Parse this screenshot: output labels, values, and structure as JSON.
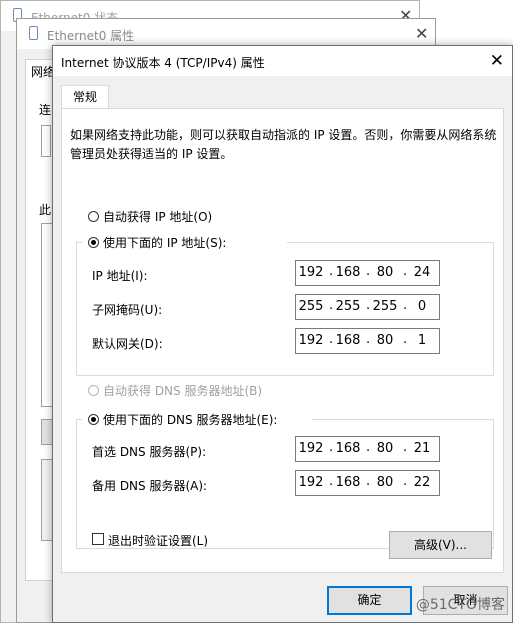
{
  "back_window_1": {
    "title": "Ethernet0 状态"
  },
  "back_window_2": {
    "title": "Ethernet0 属性",
    "tab_fragment": "网络",
    "text_fragment_1": "连",
    "text_fragment_2": "此"
  },
  "dialog": {
    "title": "Internet 协议版本 4 (TCP/IPv4) 属性",
    "tabs": [
      {
        "label": "常规"
      }
    ],
    "description": "如果网络支持此功能，则可以获取自动指派的 IP 设置。否则，你需要从网络系统管理员处获得适当的 IP 设置。",
    "ip_section": {
      "auto_label": "自动获得 IP 地址(O)",
      "manual_label": "使用下面的 IP 地址(S):",
      "fields": [
        {
          "label": "IP 地址(I):",
          "octets": [
            "192",
            "168",
            "80",
            "24"
          ]
        },
        {
          "label": "子网掩码(U):",
          "octets": [
            "255",
            "255",
            "255",
            "0"
          ]
        },
        {
          "label": "默认网关(D):",
          "octets": [
            "192",
            "168",
            "80",
            "1"
          ]
        }
      ]
    },
    "dns_section": {
      "auto_label": "自动获得 DNS 服务器地址(B)",
      "manual_label": "使用下面的 DNS 服务器地址(E):",
      "fields": [
        {
          "label": "首选 DNS 服务器(P):",
          "octets": [
            "192",
            "168",
            "80",
            "21"
          ]
        },
        {
          "label": "备用 DNS 服务器(A):",
          "octets": [
            "192",
            "168",
            "80",
            "22"
          ]
        }
      ]
    },
    "validate_label": "退出时验证设置(L)",
    "advanced_label": "高级(V)...",
    "ok_label": "确定",
    "cancel_label": "取消"
  },
  "watermark": "@51CTO博客"
}
